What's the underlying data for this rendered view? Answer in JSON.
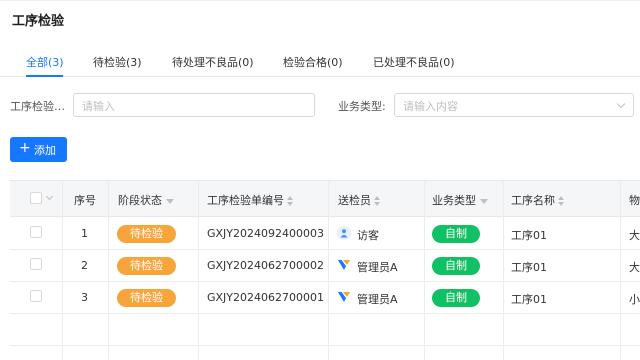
{
  "page": {
    "title": "工序检验"
  },
  "tabs": [
    {
      "label": "全部(3)",
      "active": true
    },
    {
      "label": "待检验(3)",
      "active": false
    },
    {
      "label": "待处理不良品(0)",
      "active": false
    },
    {
      "label": "检验合格(0)",
      "active": false
    },
    {
      "label": "已处理不良品(0)",
      "active": false
    }
  ],
  "filters": {
    "inspection_label": "工序检验…",
    "inspection_placeholder": "请输入",
    "business_type_label": "业务类型:",
    "business_type_placeholder": "请输入内容"
  },
  "toolbar": {
    "add_label": "添加"
  },
  "table": {
    "columns": [
      "序号",
      "阶段状态",
      "工序检验单编号",
      "送检员",
      "业务类型",
      "工序名称",
      "物"
    ],
    "rows": [
      {
        "index": "1",
        "status": "待检验",
        "number": "GXJY2024092400003",
        "inspector": "访客",
        "inspector_icon": "user-icon",
        "business_type": "自制",
        "process": "工序01",
        "extra": "大"
      },
      {
        "index": "2",
        "status": "待检验",
        "number": "GXJY2024062700002",
        "inspector": "管理员A",
        "inspector_icon": "brand-logo-icon",
        "business_type": "自制",
        "process": "工序01",
        "extra": "大"
      },
      {
        "index": "3",
        "status": "待检验",
        "number": "GXJY2024062700001",
        "inspector": "管理员A",
        "inspector_icon": "brand-logo-icon",
        "business_type": "自制",
        "process": "工序01",
        "extra": "小"
      }
    ]
  },
  "colors": {
    "accent": "#1677ff",
    "status_pending": "#f7a53a",
    "business_self": "#12c064"
  }
}
